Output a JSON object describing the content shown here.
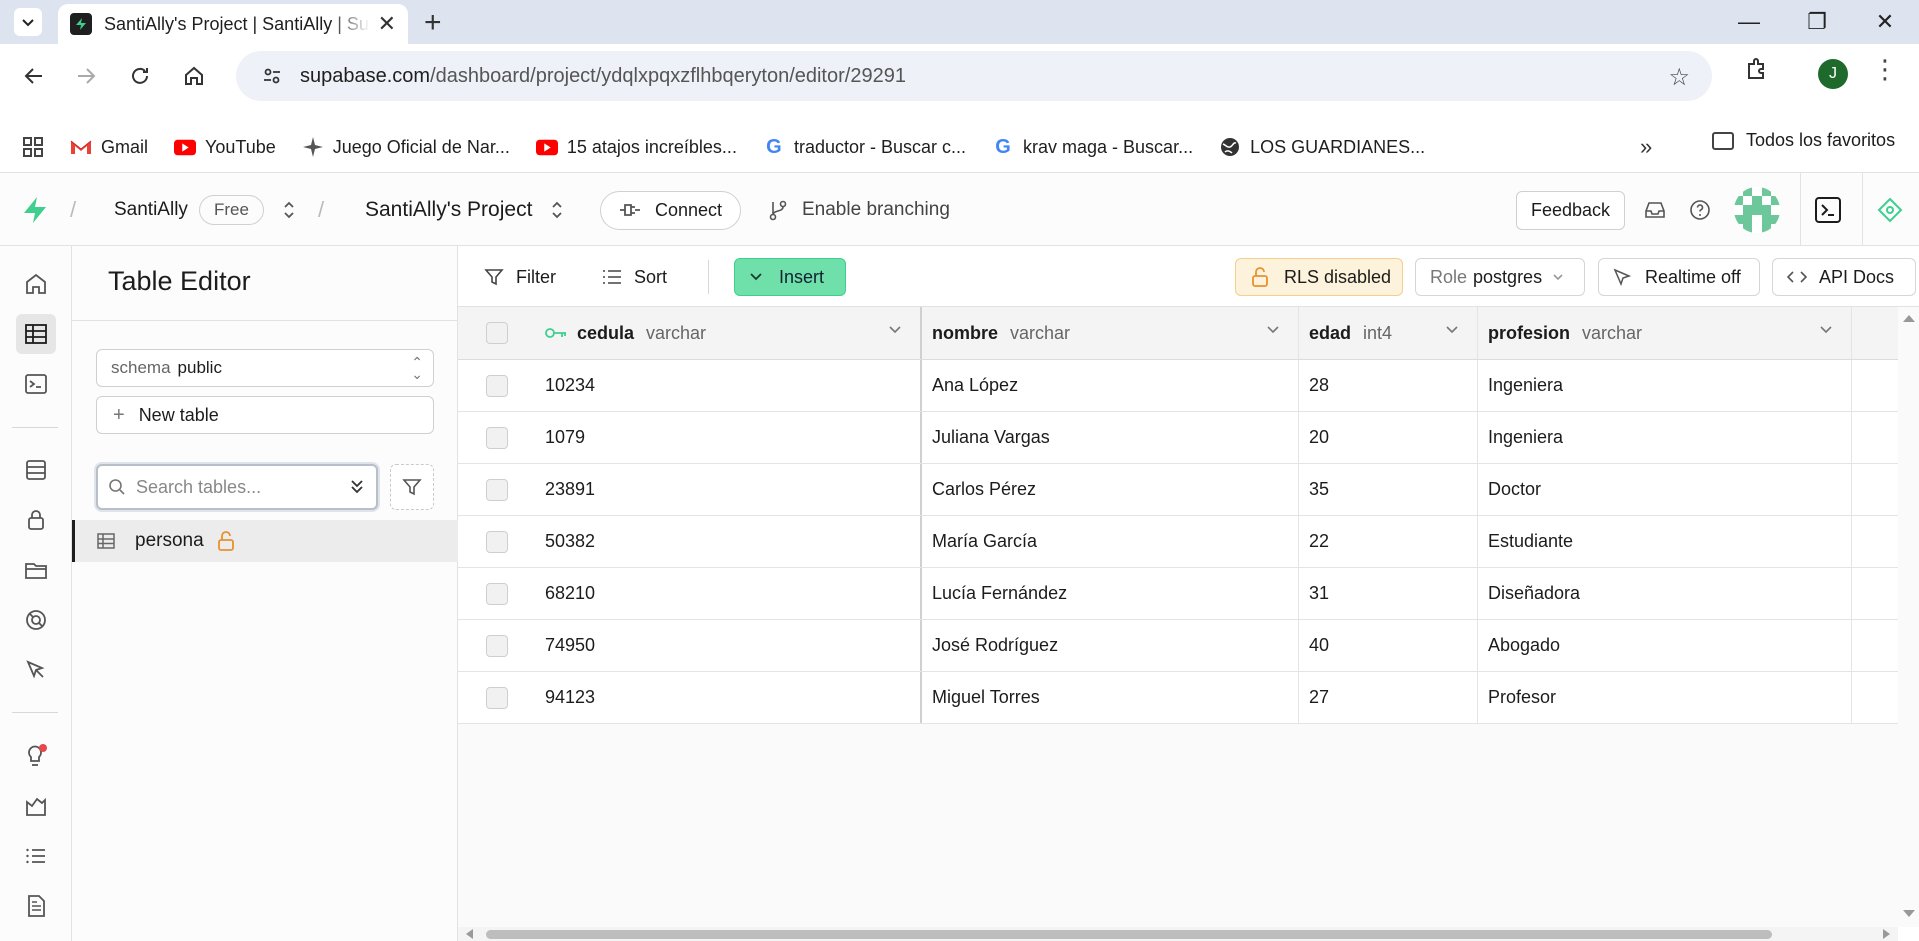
{
  "browser": {
    "tab_title": "SantiAlly's Project | SantiAlly | Supabase",
    "url_host": "supabase.com",
    "url_path": "/dashboard/project/ydqlxpqxzflhbqeryton/editor/29291",
    "profile_initial": "J",
    "bookmarks": [
      {
        "label": "Gmail",
        "icon": "gmail-icon"
      },
      {
        "label": "YouTube",
        "icon": "youtube-icon"
      },
      {
        "label": "Juego Oficial de Nar...",
        "icon": "shuriken-icon"
      },
      {
        "label": "15 atajos increíbles...",
        "icon": "youtube-icon"
      },
      {
        "label": "traductor - Buscar c...",
        "icon": "google-icon"
      },
      {
        "label": "krav maga - Buscar...",
        "icon": "google-icon"
      },
      {
        "label": "LOS GUARDIANES...",
        "icon": "globe-icon"
      }
    ],
    "all_bookmarks_label": "Todos los favoritos"
  },
  "header": {
    "org_name": "SantiAlly",
    "plan_badge": "Free",
    "project_name": "SantiAlly's Project",
    "connect_label": "Connect",
    "branching_label": "Enable branching",
    "feedback_label": "Feedback"
  },
  "sidebar": {
    "title": "Table Editor",
    "schema_prefix": "schema",
    "schema_value": "public",
    "new_table_label": "New table",
    "search_placeholder": "Search tables...",
    "tables": [
      {
        "name": "persona"
      }
    ]
  },
  "toolbar": {
    "filter_label": "Filter",
    "sort_label": "Sort",
    "insert_label": "Insert",
    "rls_label": "RLS disabled",
    "role_prefix": "Role",
    "role_value": "postgres",
    "realtime_label": "Realtime off",
    "api_docs_label": "API Docs"
  },
  "grid": {
    "columns": [
      {
        "name": "cedula",
        "type": "varchar"
      },
      {
        "name": "nombre",
        "type": "varchar"
      },
      {
        "name": "edad",
        "type": "int4"
      },
      {
        "name": "profesion",
        "type": "varchar"
      }
    ],
    "rows": [
      [
        "10234",
        "Ana López",
        "28",
        "Ingeniera"
      ],
      [
        "1079",
        "Juliana Vargas",
        "20",
        "Ingeniera"
      ],
      [
        "23891",
        "Carlos Pérez",
        "35",
        "Doctor"
      ],
      [
        "50382",
        "María García",
        "22",
        "Estudiante"
      ],
      [
        "68210",
        "Lucía Fernández",
        "31",
        "Diseñadora"
      ],
      [
        "74950",
        "José Rodríguez",
        "40",
        "Abogado"
      ],
      [
        "94123",
        "Miguel Torres",
        "27",
        "Profesor"
      ]
    ]
  },
  "colors": {
    "brand_green": "#3ecf8e",
    "insert_bg": "#6fe0a9",
    "rls_bg": "#fdf2dc",
    "lock_orange": "#e8912d"
  }
}
